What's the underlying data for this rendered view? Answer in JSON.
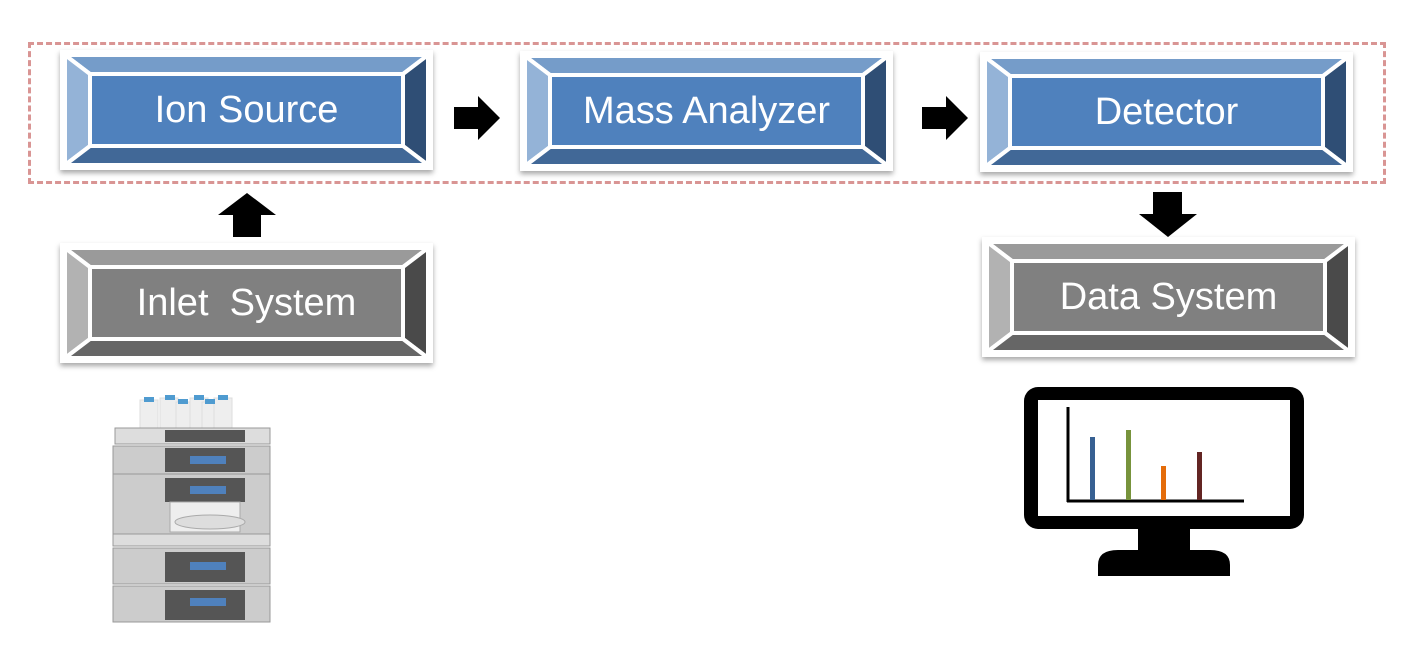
{
  "diagram": {
    "group_border_color": "#d99594",
    "boxes": {
      "ion_source": {
        "label": "Ion Source",
        "color": "#4f81bd"
      },
      "mass_analyzer": {
        "label": "Mass Analyzer",
        "color": "#4f81bd"
      },
      "detector": {
        "label": "Detector",
        "color": "#4f81bd"
      },
      "inlet_system": {
        "label": "Inlet  System",
        "color": "#808080"
      },
      "data_system": {
        "label": "Data System",
        "color": "#808080"
      }
    },
    "icons": {
      "inlet": "lc-instrument-stack-icon",
      "data": "monitor-bar-chart-icon"
    },
    "monitor_bar_colors": [
      "#376092",
      "#77933c",
      "#e46c0a",
      "#632523"
    ]
  }
}
